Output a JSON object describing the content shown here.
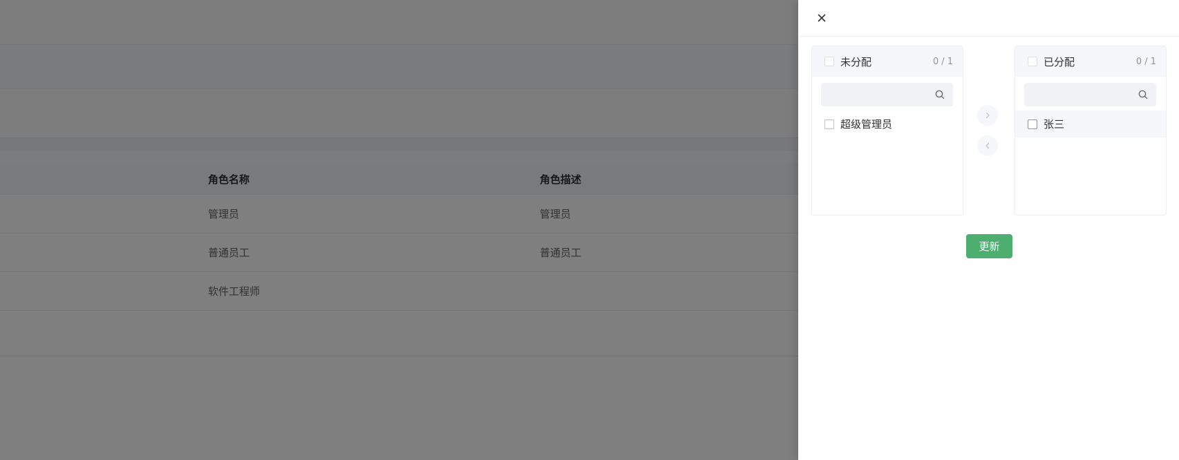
{
  "role_table": {
    "headers": {
      "name": "角色名称",
      "description": "角色描述"
    },
    "rows": [
      {
        "name": "管理员",
        "description": "管理员"
      },
      {
        "name": "普通员工",
        "description": "普通员工"
      },
      {
        "name": "软件工程师",
        "description": ""
      }
    ]
  },
  "drawer": {
    "close_icon": "close-icon",
    "transfer": {
      "left_panel": {
        "title": "未分配",
        "count": "0 / 1",
        "search_placeholder": "",
        "items": [
          {
            "label": "超级管理员"
          }
        ]
      },
      "right_panel": {
        "title": "已分配",
        "count": "0 / 1",
        "search_placeholder": "",
        "items": [
          {
            "label": "张三"
          }
        ]
      },
      "move_right_icon": "chevron-right-icon",
      "move_left_icon": "chevron-left-icon"
    },
    "update_button": "更新"
  },
  "colors": {
    "primary_button": "#4cae6f",
    "mask": "rgba(0,0,0,0.5)"
  }
}
